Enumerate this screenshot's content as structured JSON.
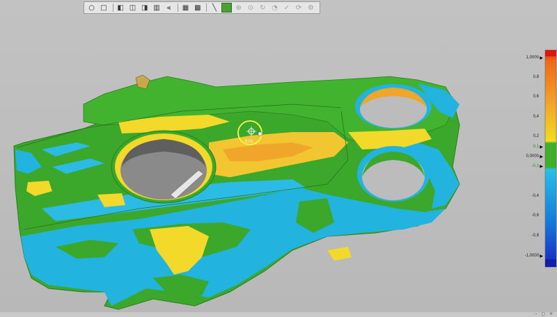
{
  "toolbar": {
    "tools": [
      {
        "name": "select-circle-icon",
        "glyph": "○"
      },
      {
        "name": "select-box-icon",
        "glyph": "□"
      },
      {
        "name": "view-iso-icon",
        "glyph": "◧"
      },
      {
        "name": "view-front-icon",
        "glyph": "◫"
      },
      {
        "name": "view-top-icon",
        "glyph": "◨"
      },
      {
        "name": "view-side-icon",
        "glyph": "▥"
      },
      {
        "name": "align-icon",
        "glyph": "⫷"
      },
      {
        "name": "grid-icon",
        "glyph": "▦"
      },
      {
        "name": "grid-alt-icon",
        "glyph": "▩"
      },
      {
        "name": "line-tool-icon",
        "glyph": "╲"
      },
      {
        "name": "color-map-icon",
        "glyph": "■"
      },
      {
        "name": "point-icon",
        "glyph": "⊕"
      },
      {
        "name": "target-icon",
        "glyph": "⊙"
      },
      {
        "name": "rotate-icon",
        "glyph": "↻"
      },
      {
        "name": "gauge-icon",
        "glyph": "◔"
      },
      {
        "name": "check-icon",
        "glyph": "✓"
      },
      {
        "name": "refresh-icon",
        "glyph": "⟳"
      },
      {
        "name": "settings-icon",
        "glyph": "⚙"
      }
    ]
  },
  "probe": {
    "label": "0.01"
  },
  "legend": {
    "labels": [
      {
        "text": "1,0000",
        "type": "max"
      },
      {
        "text": "0,8"
      },
      {
        "text": "0,6"
      },
      {
        "text": "0,4"
      },
      {
        "text": "0,2"
      },
      {
        "text": "0,1",
        "type": "green"
      },
      {
        "text": "0,0000",
        "type": "zero"
      },
      {
        "text": "-0,1",
        "type": "green"
      },
      {
        "text": "-0,4"
      },
      {
        "text": "-0,6"
      },
      {
        "text": "-0,8"
      },
      {
        "text": "-1,0000",
        "type": "min"
      }
    ],
    "colors": {
      "red": "#e01a10",
      "orange": "#f38a12",
      "yellow": "#f3dc1e",
      "green": "#3eb02c",
      "cyan": "#1fb4e0",
      "blue": "#1848d8",
      "navy": "#1020a8"
    }
  },
  "window": {
    "controls": "–  ▢  ✕"
  }
}
